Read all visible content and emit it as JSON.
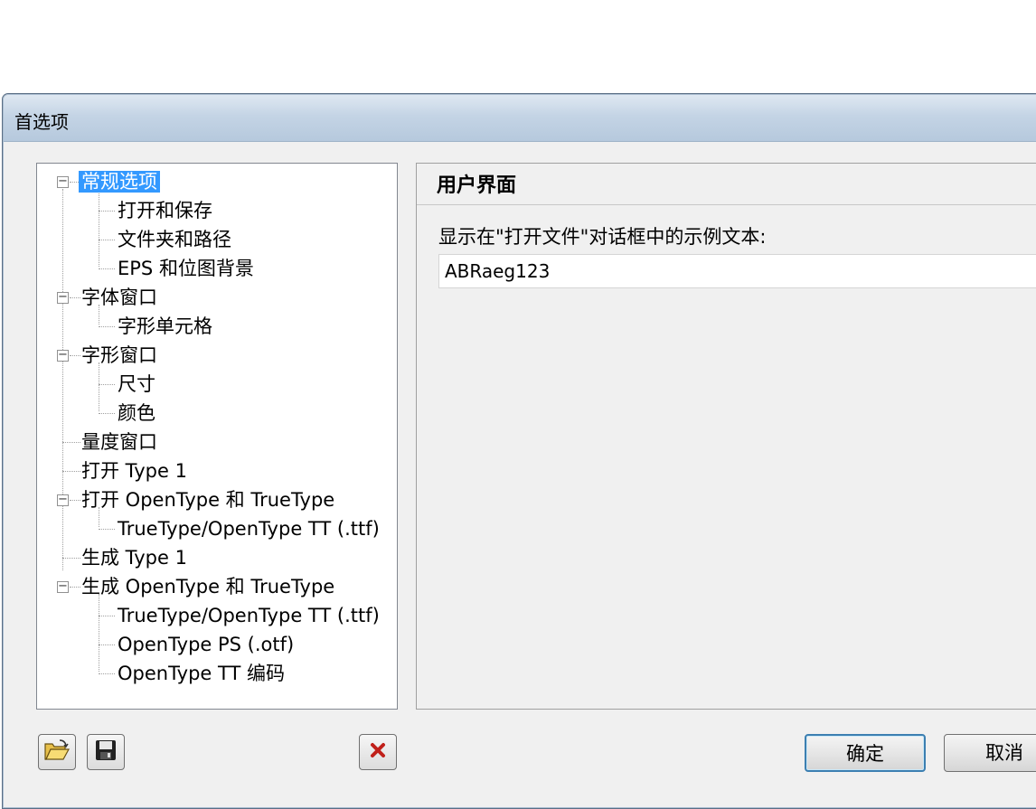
{
  "window": {
    "title": "首选项"
  },
  "tree": {
    "items": [
      {
        "label": "常规选项",
        "selected": true
      },
      {
        "label": "打开和保存"
      },
      {
        "label": "文件夹和路径"
      },
      {
        "label": "EPS 和位图背景"
      },
      {
        "label": "字体窗口"
      },
      {
        "label": "字形单元格"
      },
      {
        "label": "字形窗口"
      },
      {
        "label": "尺寸"
      },
      {
        "label": "颜色"
      },
      {
        "label": "量度窗口"
      },
      {
        "label": "打开 Type 1"
      },
      {
        "label": "打开 OpenType 和 TrueType"
      },
      {
        "label": "TrueType/OpenType TT (.ttf)"
      },
      {
        "label": "生成 Type 1"
      },
      {
        "label": "生成 OpenType 和 TrueType"
      },
      {
        "label": "TrueType/OpenType TT (.ttf)"
      },
      {
        "label": "OpenType PS (.otf)"
      },
      {
        "label": "OpenType TT 编码"
      }
    ]
  },
  "panel": {
    "header": "用户界面",
    "sample_label": "显示在\"打开文件\"对话框中的示例文本:",
    "sample_value": "ABRaeg123"
  },
  "buttons": {
    "ok": "确定",
    "cancel": "取消",
    "open_icon": "folder-open-icon",
    "save_icon": "save-disk-icon",
    "delete_icon": "close-x-icon"
  },
  "colors": {
    "selection": "#3399ff",
    "delete_red": "#c0201a",
    "default_button_border": "#3c7fb1"
  }
}
